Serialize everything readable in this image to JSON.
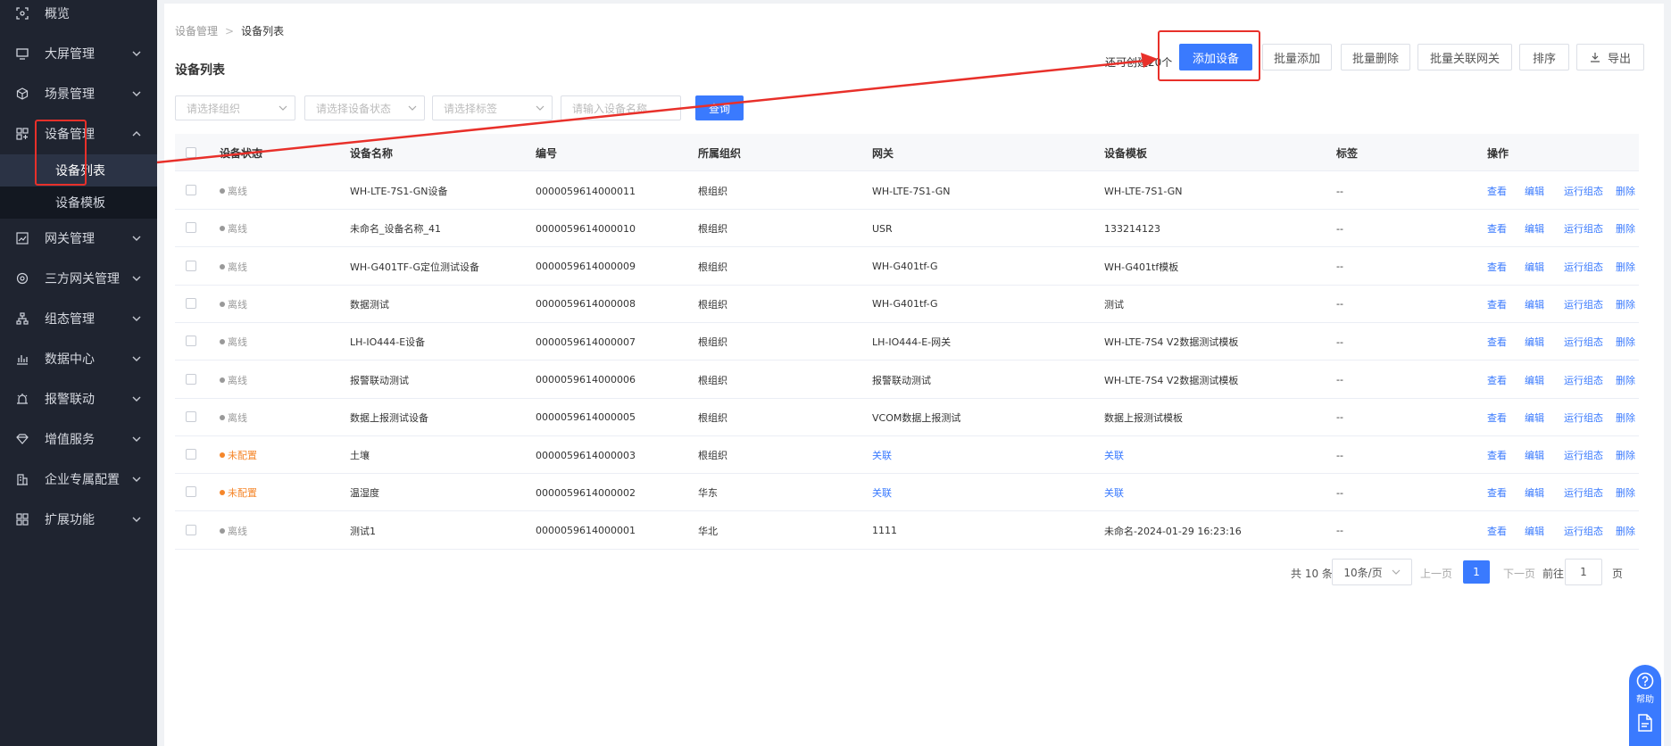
{
  "sidebar": {
    "items": [
      {
        "label": "概览",
        "icon": "overview-icon",
        "has_children": false
      },
      {
        "label": "大屏管理",
        "icon": "monitor-icon",
        "has_children": true
      },
      {
        "label": "场景管理",
        "icon": "cube-icon",
        "has_children": true
      },
      {
        "label": "设备管理",
        "icon": "device-grid-icon",
        "has_children": true,
        "expanded": true
      },
      {
        "label": "网关管理",
        "icon": "chart-line-icon",
        "has_children": true
      },
      {
        "label": "三方网关管理",
        "icon": "network-icon",
        "has_children": true
      },
      {
        "label": "组态管理",
        "icon": "topology-icon",
        "has_children": true
      },
      {
        "label": "数据中心",
        "icon": "bar-chart-icon",
        "has_children": true
      },
      {
        "label": "报警联动",
        "icon": "alarm-icon",
        "has_children": true
      },
      {
        "label": "增值服务",
        "icon": "diamond-icon",
        "has_children": true
      },
      {
        "label": "企业专属配置",
        "icon": "building-icon",
        "has_children": true
      },
      {
        "label": "扩展功能",
        "icon": "apps-icon",
        "has_children": true
      }
    ],
    "submenu": [
      {
        "label": "设备列表",
        "active": true
      },
      {
        "label": "设备模板",
        "active": false
      }
    ]
  },
  "breadcrumb": {
    "parent": "设备管理",
    "separator": ">",
    "current": "设备列表"
  },
  "page_title": "设备列表",
  "toolbar": {
    "remain_text": "还可创建20个",
    "add_label": "添加设备",
    "batch_add_label": "批量添加",
    "batch_delete_label": "批量删除",
    "batch_gateway_label": "批量关联网关",
    "sort_label": "排序",
    "export_label": "导出"
  },
  "filters": {
    "org_placeholder": "请选择组织",
    "status_placeholder": "请选择设备状态",
    "tag_placeholder": "请选择标签",
    "name_placeholder": "请输入设备名称",
    "query_label": "查询"
  },
  "table": {
    "columns": [
      "设备状态",
      "设备名称",
      "编号",
      "所属组织",
      "网关",
      "设备模板",
      "标签",
      "操作"
    ],
    "actions": [
      "查看",
      "编辑",
      "运行组态",
      "删除"
    ],
    "rows": [
      {
        "status": "离线",
        "status_color": "#999999",
        "name": "WH-LTE-7S1-GN设备",
        "code": "0000059614000011",
        "org": "根组织",
        "gateway": "WH-LTE-7S1-GN",
        "gateway_link": false,
        "template": "WH-LTE-7S1-GN",
        "template_link": false,
        "tag": "--"
      },
      {
        "status": "离线",
        "status_color": "#999999",
        "name": "未命名_设备名称_41",
        "code": "0000059614000010",
        "org": "根组织",
        "gateway": "USR",
        "gateway_link": false,
        "template": "133214123",
        "template_link": false,
        "tag": "--"
      },
      {
        "status": "离线",
        "status_color": "#999999",
        "name": "WH-G401TF-G定位测试设备",
        "code": "0000059614000009",
        "org": "根组织",
        "gateway": "WH-G401tf-G",
        "gateway_link": false,
        "template": "WH-G401tf模板",
        "template_link": false,
        "tag": "--"
      },
      {
        "status": "离线",
        "status_color": "#999999",
        "name": "数据测试",
        "code": "0000059614000008",
        "org": "根组织",
        "gateway": "WH-G401tf-G",
        "gateway_link": false,
        "template": "测试",
        "template_link": false,
        "tag": "--"
      },
      {
        "status": "离线",
        "status_color": "#999999",
        "name": "LH-IO444-E设备",
        "code": "0000059614000007",
        "org": "根组织",
        "gateway": "LH-IO444-E-网关",
        "gateway_link": false,
        "template": "WH-LTE-7S4 V2数据测试模板",
        "template_link": false,
        "tag": "--"
      },
      {
        "status": "离线",
        "status_color": "#999999",
        "name": "报警联动测试",
        "code": "0000059614000006",
        "org": "根组织",
        "gateway": "报警联动测试",
        "gateway_link": false,
        "template": "WH-LTE-7S4 V2数据测试模板",
        "template_link": false,
        "tag": "--"
      },
      {
        "status": "离线",
        "status_color": "#999999",
        "name": "数据上报测试设备",
        "code": "0000059614000005",
        "org": "根组织",
        "gateway": "VCOM数据上报测试",
        "gateway_link": false,
        "template": "数据上报测试模板",
        "template_link": false,
        "tag": "--"
      },
      {
        "status": "未配置",
        "status_color": "#f5862a",
        "name": "土壤",
        "code": "0000059614000003",
        "org": "根组织",
        "gateway": "关联",
        "gateway_link": true,
        "template": "关联",
        "template_link": true,
        "tag": "--"
      },
      {
        "status": "未配置",
        "status_color": "#f5862a",
        "name": "温湿度",
        "code": "0000059614000002",
        "org": "华东",
        "gateway": "关联",
        "gateway_link": true,
        "template": "关联",
        "template_link": true,
        "tag": "--"
      },
      {
        "status": "离线",
        "status_color": "#999999",
        "name": "测试1",
        "code": "0000059614000001",
        "org": "华北",
        "gateway": "1111",
        "gateway_link": false,
        "template": "未命名-2024-01-29 16:23:16",
        "template_link": false,
        "tag": "--"
      }
    ]
  },
  "pagination": {
    "total_text": "共 10 条",
    "page_size": "10条/页",
    "prev_label": "上一页",
    "current_page": "1",
    "next_label": "下一页",
    "goto_label": "前往",
    "goto_value": "1",
    "page_unit": "页"
  },
  "help": {
    "label": "帮助"
  },
  "colors": {
    "primary": "#3a7afe",
    "sidebar_bg": "#1f2430",
    "annotation_red": "#e8302a",
    "warning": "#f5862a",
    "offline": "#999999"
  }
}
